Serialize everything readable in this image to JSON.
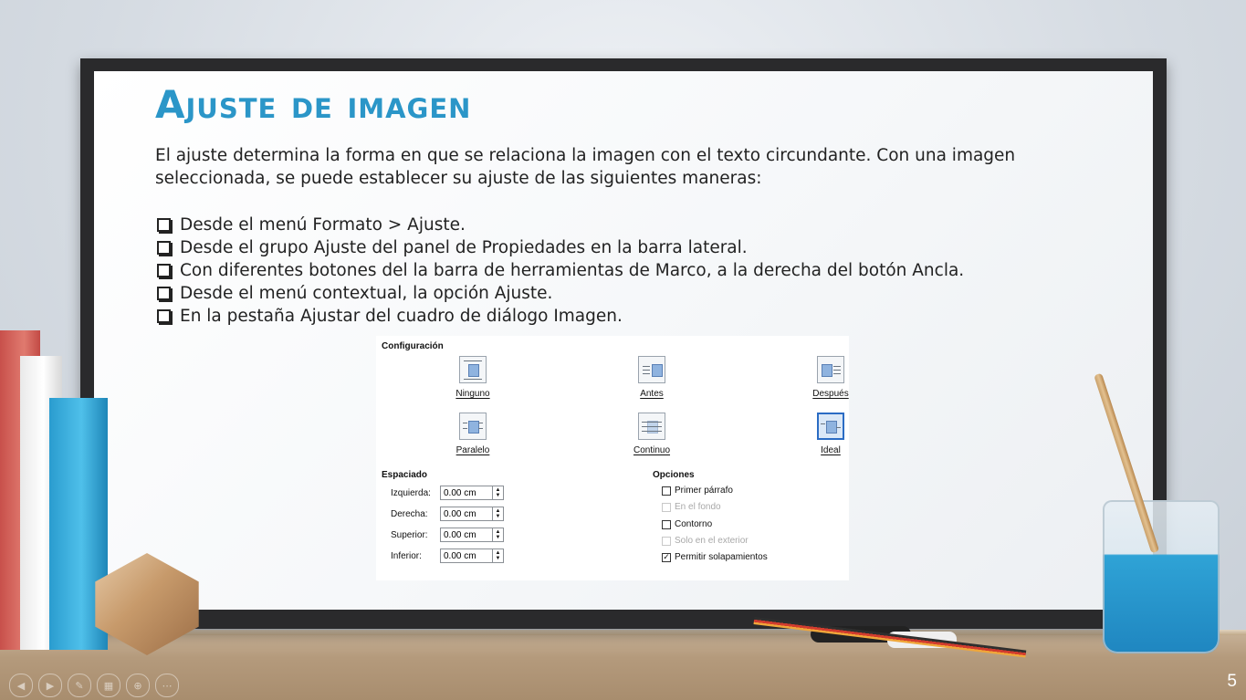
{
  "slide": {
    "title": "Ajuste de imagen",
    "intro": "El ajuste determina la forma en que se relaciona la imagen con el texto circundante. Con una imagen seleccionada, se puede establecer su ajuste de las siguientes maneras:",
    "bullets": [
      "Desde el menú Formato > Ajuste.",
      "Desde el grupo Ajuste del panel de Propiedades en la barra lateral.",
      "Con diferentes botones del la barra de herramientas de Marco, a la derecha del botón Ancla.",
      "Desde el menú contextual, la opción Ajuste.",
      "En la pestaña Ajustar del cuadro de diálogo Imagen."
    ],
    "page_number": "5"
  },
  "dialog": {
    "config_heading": "Configuración",
    "wrap_options": [
      {
        "label": "Ninguno",
        "selected": false
      },
      {
        "label": "Antes",
        "selected": false
      },
      {
        "label": "Después",
        "selected": false
      },
      {
        "label": "Paralelo",
        "selected": false
      },
      {
        "label": "Continuo",
        "selected": false
      },
      {
        "label": "Ideal",
        "selected": true
      }
    ],
    "spacing_heading": "Espaciado",
    "spacing": [
      {
        "label": "Izquierda:",
        "value": "0.00 cm"
      },
      {
        "label": "Derecha:",
        "value": "0.00 cm"
      },
      {
        "label": "Superior:",
        "value": "0.00 cm"
      },
      {
        "label": "Inferior:",
        "value": "0.00 cm"
      }
    ],
    "options_heading": "Opciones",
    "options": [
      {
        "label": "Primer párrafo",
        "checked": false,
        "enabled": true
      },
      {
        "label": "En el fondo",
        "checked": false,
        "enabled": false
      },
      {
        "label": "Contorno",
        "checked": false,
        "enabled": true
      },
      {
        "label": "Solo en el exterior",
        "checked": false,
        "enabled": false
      },
      {
        "label": "Permitir solapamientos",
        "checked": true,
        "enabled": true
      }
    ]
  },
  "colors": {
    "title": "#2b96c8",
    "selected_border": "#2b6cc4"
  },
  "toolbar_icons": [
    "prev-icon",
    "next-icon",
    "pen-icon",
    "slides-icon",
    "zoom-icon",
    "more-icon"
  ]
}
